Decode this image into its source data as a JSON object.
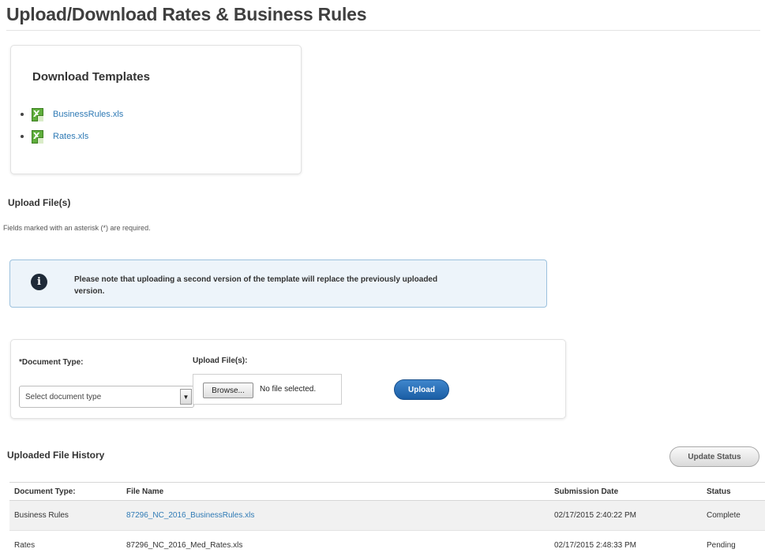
{
  "page": {
    "title": "Upload/Download Rates & Business Rules"
  },
  "templates": {
    "heading": "Download Templates",
    "items": [
      {
        "label": "BusinessRules.xls",
        "icon": "excel-file-icon"
      },
      {
        "label": "Rates.xls",
        "icon": "excel-file-icon"
      }
    ]
  },
  "upload": {
    "heading": "Upload File(s)",
    "required_note": "Fields marked with an asterisk (*) are required.",
    "info_message": "Please note that uploading a second version of the template will replace the previously uploaded version.",
    "info_icon": "info-icon",
    "doc_type_label": "*Document Type:",
    "doc_type_value": "Select document type",
    "files_label": "Upload File(s):",
    "browse_label": "Browse...",
    "no_file_text": "No file selected.",
    "upload_button": "Upload"
  },
  "history": {
    "heading": "Uploaded File History",
    "update_status_button": "Update Status",
    "columns": [
      "Document Type:",
      "File Name",
      "Submission Date",
      "Status"
    ],
    "rows": [
      {
        "type": "Business Rules",
        "file_name": "87296_NC_2016_BusinessRules.xls",
        "date": "02/17/2015 2:40:22 PM",
        "status": "Complete"
      },
      {
        "type": "Rates",
        "file_name": "87296_NC_2016_Med_Rates.xls",
        "date": "02/17/2015 2:48:33 PM",
        "status": "Pending"
      }
    ]
  },
  "colors": {
    "link": "#2f7ab5",
    "primary_button": "#1b5ea5",
    "info_bg": "#edf4fa",
    "info_border": "#9cc1de",
    "excel_green": "#5fae3c"
  }
}
